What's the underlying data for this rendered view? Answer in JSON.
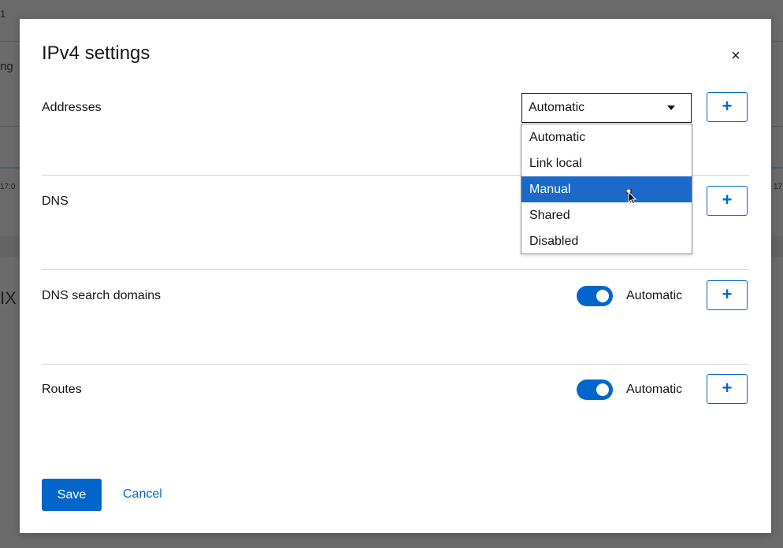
{
  "background": {
    "fragments": [
      "1",
      "ng",
      "17:0",
      "17",
      "IX"
    ]
  },
  "dialog": {
    "title": "IPv4 settings",
    "close_label": "×",
    "sections": {
      "addresses": {
        "label": "Addresses",
        "add_label": "+"
      },
      "dns": {
        "label": "DNS",
        "add_label": "+"
      },
      "dns_search": {
        "label": "DNS search domains",
        "toggle_label": "Automatic",
        "toggle_on": true,
        "add_label": "+"
      },
      "routes": {
        "label": "Routes",
        "toggle_label": "Automatic",
        "toggle_on": true,
        "add_label": "+"
      }
    },
    "method_select": {
      "value": "Automatic",
      "options": [
        "Automatic",
        "Link local",
        "Manual",
        "Shared",
        "Disabled"
      ],
      "highlighted": "Manual"
    },
    "footer": {
      "save_label": "Save",
      "cancel_label": "Cancel"
    }
  },
  "colors": {
    "accent": "#0066cc",
    "highlight": "#1b6ac9",
    "overlay": "#6b6b6b"
  }
}
